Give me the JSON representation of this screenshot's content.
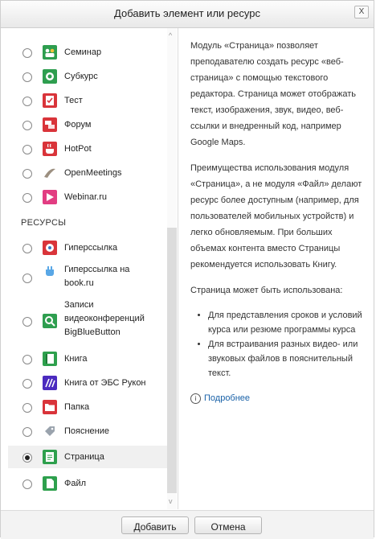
{
  "dialog": {
    "title": "Добавить элемент или ресурс",
    "close_label": "X"
  },
  "activities": [
    {
      "label": "Семинар",
      "icon": "workshop-icon"
    },
    {
      "label": "Субкурс",
      "icon": "subcourse-icon"
    },
    {
      "label": "Тест",
      "icon": "quiz-icon"
    },
    {
      "label": "Форум",
      "icon": "forum-icon"
    },
    {
      "label": "HotPot",
      "icon": "hotpot-icon"
    },
    {
      "label": "OpenMeetings",
      "icon": "openmeetings-icon"
    },
    {
      "label": "Webinar.ru",
      "icon": "webinar-icon"
    }
  ],
  "resources_heading": "РЕСУРСЫ",
  "resources": [
    {
      "label": "Гиперссылка",
      "icon": "url-icon"
    },
    {
      "label": "Гиперссылка на book.ru",
      "icon": "bookru-icon"
    },
    {
      "label": "Записи видеоконференций BigBlueButton",
      "icon": "bigbluebutton-icon"
    },
    {
      "label": "Книга",
      "icon": "book-icon"
    },
    {
      "label": "Книга от ЭБС Рукон",
      "icon": "rucont-icon"
    },
    {
      "label": "Папка",
      "icon": "folder-icon"
    },
    {
      "label": "Пояснение",
      "icon": "label-icon"
    },
    {
      "label": "Страница",
      "icon": "page-icon",
      "selected": true
    },
    {
      "label": "Файл",
      "icon": "file-icon"
    }
  ],
  "description": {
    "p1": "Модуль «Страница» позволяет преподавателю создать ресурс «веб-страница» с помощью текстового редактора. Страница может отображать текст, изображения, звук, видео, веб-ссылки и внедренный код, например Google Maps.",
    "p2": "Преимущества использования модуля «Страница», а не модуля «Файл» делают ресурс более доступным (например, для пользователей мобильных устройств) и легко обновляемым. При больших объемах контента вместо Страницы рекомендуется использовать Книгу.",
    "p3": "Страница может быть использована:",
    "bullets": [
      "Для представления сроков и условий курса или резюме программы курса",
      "Для встраивания разных видео- или звуковых файлов в пояснительный текст."
    ],
    "more_link": "Подробнее"
  },
  "footer": {
    "add_label": "Добавить",
    "cancel_label": "Отмена"
  },
  "colors": {
    "link": "#1a62a8",
    "quiz": "#d9343a",
    "forum": "#d9343a",
    "subcourse": "#2e9e4f",
    "webinar": "#e23d82",
    "book": "#2ea04d",
    "rucont": "#4b2bbf",
    "page": "#2ea04d",
    "file": "#2ea04d"
  }
}
